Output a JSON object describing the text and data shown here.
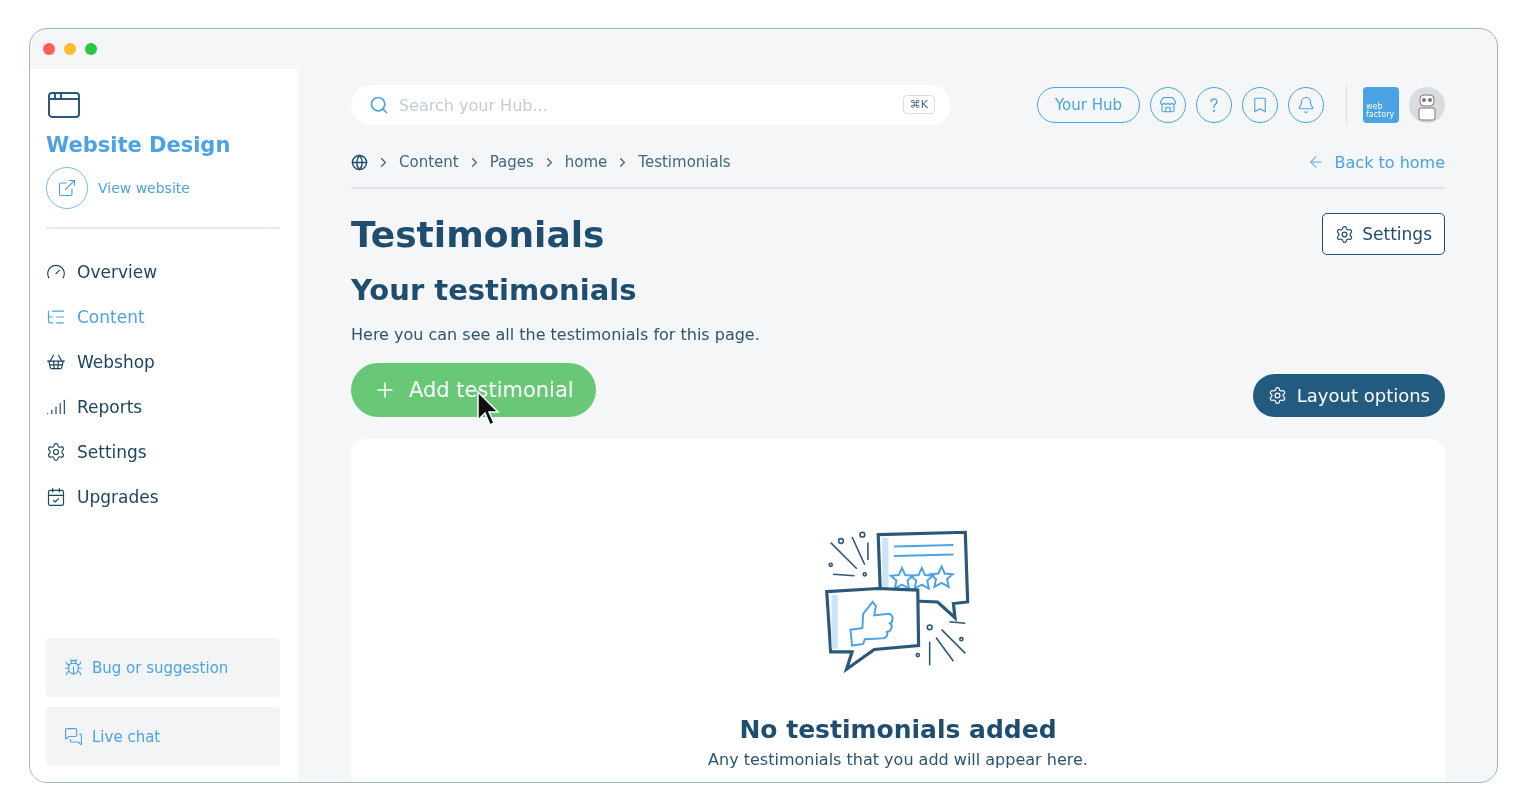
{
  "sidebar": {
    "site_title": "Website Design",
    "view_website": "View website",
    "items": [
      {
        "label": "Overview",
        "kind": "overview",
        "selected": false
      },
      {
        "label": "Content",
        "kind": "content",
        "selected": true
      },
      {
        "label": "Webshop",
        "kind": "webshop",
        "selected": false
      },
      {
        "label": "Reports",
        "kind": "reports",
        "selected": false
      },
      {
        "label": "Settings",
        "kind": "settings",
        "selected": false
      },
      {
        "label": "Upgrades",
        "kind": "upgrades",
        "selected": false
      }
    ],
    "footer_buttons": [
      {
        "label": "Bug or suggestion",
        "kind": "bug"
      },
      {
        "label": "Live chat",
        "kind": "chat"
      }
    ]
  },
  "topbar": {
    "search": {
      "placeholder": "Search your Hub...",
      "shortcut": "⌘K"
    },
    "hub_button": "Your Hub",
    "icon_buttons": [
      {
        "kind": "store"
      },
      {
        "kind": "help"
      },
      {
        "kind": "bookmark"
      },
      {
        "kind": "bell"
      }
    ],
    "logo_lines": [
      "web",
      "factory"
    ]
  },
  "breadcrumb": [
    "Content",
    "Pages",
    "home",
    "Testimonials"
  ],
  "back_link": "Back to home",
  "page_title": "Testimonials",
  "settings_button": "Settings",
  "section_title": "Your testimonials",
  "section_description": "Here you can see all the testimonials for this page.",
  "add_button": "Add testimonial",
  "layout_button": "Layout options",
  "empty_state": {
    "title": "No testimonials added",
    "description": "Any testimonials that you add will appear here."
  }
}
